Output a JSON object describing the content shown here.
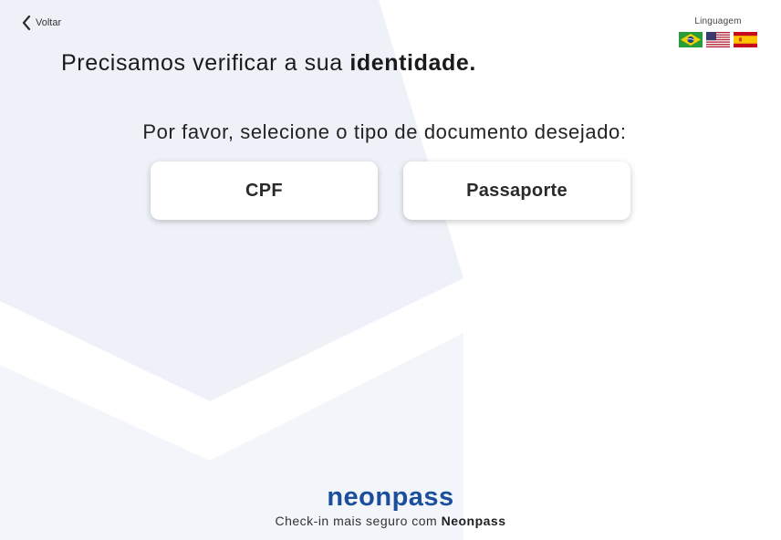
{
  "nav": {
    "back_label": "Voltar"
  },
  "language": {
    "title": "Linguagem",
    "flags": [
      "flag-brazil-icon",
      "flag-usa-icon",
      "flag-spain-icon"
    ]
  },
  "headline": {
    "text": "Precisamos verificar a sua ",
    "emphasis": "identidade."
  },
  "prompt": "Por favor, selecione o tipo de documento desejado:",
  "document_options": {
    "cpf_label": "CPF",
    "passport_label": "Passaporte"
  },
  "footer": {
    "logo": "neonpass",
    "tagline": "Check-in mais seguro com ",
    "tagline_brand": "Neonpass"
  },
  "colors": {
    "brand": "#1b4e9b",
    "background_shape": "#eef2f8"
  }
}
